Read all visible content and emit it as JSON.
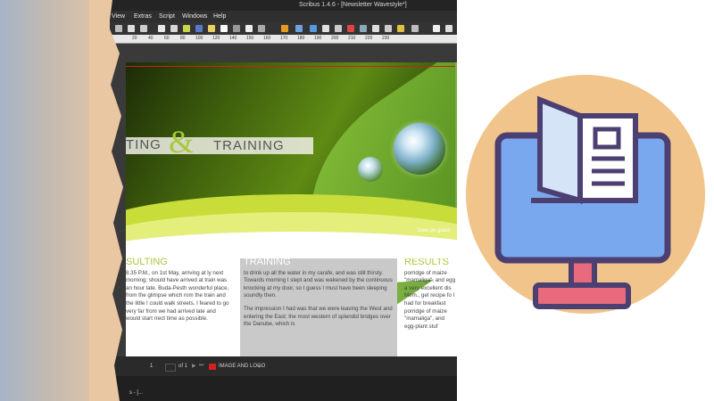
{
  "app": {
    "title": "Scribus 1.4.6 - [Newsletter Wavestyle*]",
    "menu": [
      "View",
      "Extras",
      "Script",
      "Windows",
      "Help"
    ]
  },
  "ruler": {
    "labels": [
      "20",
      "40",
      "60",
      "80",
      "100",
      "120",
      "140",
      "150",
      "160",
      "170",
      "180",
      "190",
      "200",
      "210",
      "220",
      "230"
    ]
  },
  "document": {
    "hero_word_left": "TING",
    "ampersand": "&",
    "hero_word_right": "TRAINING",
    "image_caption": "Dew on grass",
    "columns": [
      {
        "heading": "SULTING",
        "paragraphs": [
          "8.35 P.M., on 1st May, arriving at ly next morning; should have arrived at train was an hour late. Buda-Pesth wonderful place, from the glimpse which rom the train and the little I could walk streets. I feared to go very far from we had arrived late and would start rrect time as possible."
        ]
      },
      {
        "heading": "TRAINING",
        "paragraphs": [
          "to drink up all the water in my carafe, and was still thirsty. Towards morning I slept and was wakened by the continuous knocking at my door, so I guess I must have been sleeping soundly then.",
          "The impression I had was that we were leaving the West and entering the East; the most western of splendid bridges over the Danube, which is"
        ]
      },
      {
        "heading": "RESULTS",
        "paragraphs": [
          "porridge of maize \"mamaliga\", and egg a very excellent dis Mem., get recipe fo I had for breakfast porridge of maize \"mamaliga\", and egg-plant stuf"
        ]
      }
    ]
  },
  "status": {
    "page_number": "1",
    "page_of": "of 1",
    "layer_name": "IMAGE AND LOGO"
  },
  "taskbar": {
    "item": "s - [..."
  },
  "colors": {
    "accent_green": "#a8c83a",
    "illustration_bg": "#f0c48a",
    "illustration_outline": "#4c3f72",
    "illustration_blue": "#7aa8ee",
    "illustration_pink": "#e86a7d"
  },
  "icons": {
    "illustration": "monitor-with-open-book-icon"
  }
}
